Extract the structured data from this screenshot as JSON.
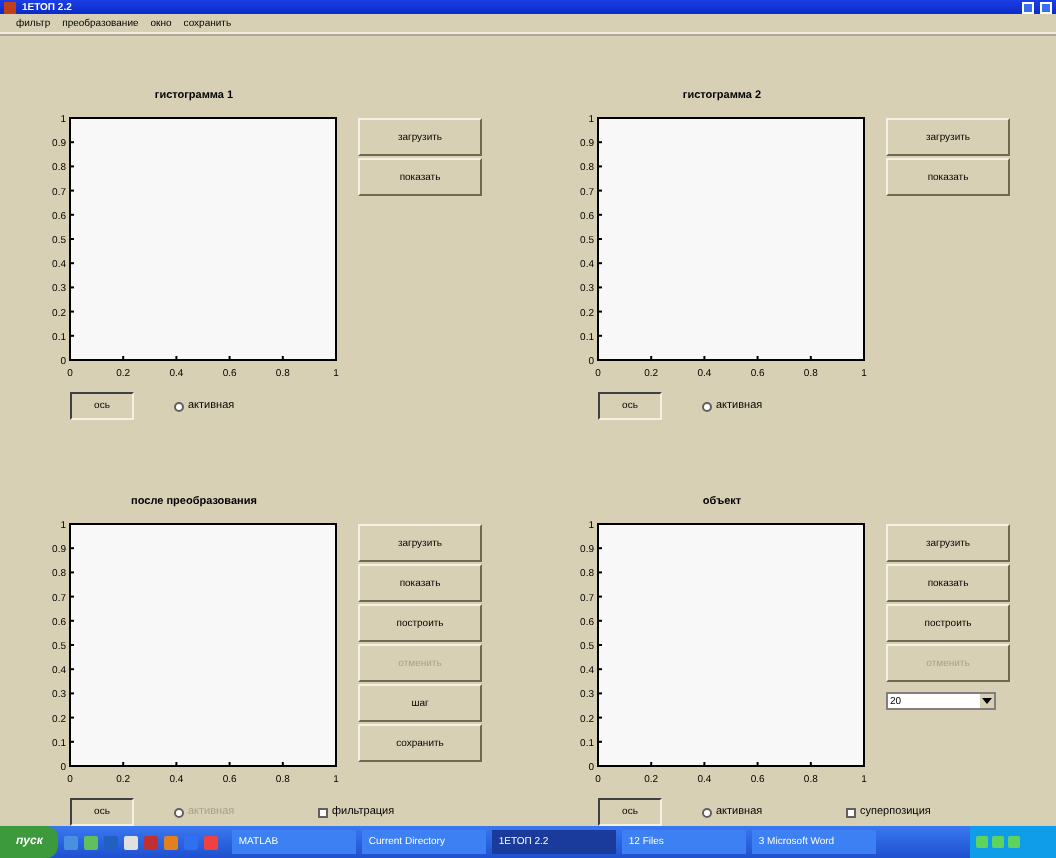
{
  "window": {
    "title": "1ЕТОП 2.2"
  },
  "menu": [
    "фильтр",
    "преобразование",
    "окно",
    "сохранить"
  ],
  "panels": [
    {
      "title": "гистограмма 1",
      "chart_data": {
        "type": "line",
        "xlim": [
          0,
          1
        ],
        "ylim": [
          0,
          1
        ],
        "xticks": [
          0,
          0.2,
          0.4,
          0.6,
          0.8,
          1
        ],
        "yticks": [
          0,
          0.1,
          0.2,
          0.3,
          0.4,
          0.5,
          0.6,
          0.7,
          0.8,
          0.9,
          1
        ]
      },
      "buttons": [
        {
          "label": "загрузить",
          "disabled": false
        },
        {
          "label": "показать",
          "disabled": false
        }
      ],
      "axis_field": {
        "value": "ось"
      },
      "options": [
        {
          "kind": "radio",
          "label": "активная",
          "checked": false,
          "disabled": false
        }
      ]
    },
    {
      "title": "гистограмма 2",
      "chart_data": {
        "type": "line",
        "xlim": [
          0,
          1
        ],
        "ylim": [
          0,
          1
        ],
        "xticks": [
          0,
          0.2,
          0.4,
          0.6,
          0.8,
          1
        ],
        "yticks": [
          0,
          0.1,
          0.2,
          0.3,
          0.4,
          0.5,
          0.6,
          0.7,
          0.8,
          0.9,
          1
        ]
      },
      "buttons": [
        {
          "label": "загрузить",
          "disabled": false
        },
        {
          "label": "показать",
          "disabled": false
        }
      ],
      "axis_field": {
        "value": "ось"
      },
      "options": [
        {
          "kind": "radio",
          "label": "активная",
          "checked": false,
          "disabled": false
        }
      ]
    },
    {
      "title": "после преобразования",
      "chart_data": {
        "type": "line",
        "xlim": [
          0,
          1
        ],
        "ylim": [
          0,
          1
        ],
        "xticks": [
          0,
          0.2,
          0.4,
          0.6,
          0.8,
          1
        ],
        "yticks": [
          0,
          0.1,
          0.2,
          0.3,
          0.4,
          0.5,
          0.6,
          0.7,
          0.8,
          0.9,
          1
        ]
      },
      "buttons": [
        {
          "label": "загрузить",
          "disabled": false
        },
        {
          "label": "показать",
          "disabled": false
        },
        {
          "label": "построить",
          "disabled": false
        },
        {
          "label": "отменить",
          "disabled": true
        },
        {
          "label": "шаг",
          "disabled": false
        },
        {
          "label": "сохранить",
          "disabled": false
        }
      ],
      "axis_field": {
        "value": "ось"
      },
      "options": [
        {
          "kind": "radio",
          "label": "активная",
          "checked": false,
          "disabled": true
        },
        {
          "kind": "checkbox",
          "label": "фильтрация",
          "checked": false,
          "disabled": false
        }
      ]
    },
    {
      "title": "объект",
      "chart_data": {
        "type": "line",
        "xlim": [
          0,
          1
        ],
        "ylim": [
          0,
          1
        ],
        "xticks": [
          0,
          0.2,
          0.4,
          0.6,
          0.8,
          1
        ],
        "yticks": [
          0,
          0.1,
          0.2,
          0.3,
          0.4,
          0.5,
          0.6,
          0.7,
          0.8,
          0.9,
          1
        ]
      },
      "buttons": [
        {
          "label": "загрузить",
          "disabled": false
        },
        {
          "label": "показать",
          "disabled": false
        },
        {
          "label": "построить",
          "disabled": false
        },
        {
          "label": "отменить",
          "disabled": true
        }
      ],
      "dropdown": {
        "value": "20"
      },
      "axis_field": {
        "value": "ось"
      },
      "options": [
        {
          "kind": "radio",
          "label": "активная",
          "checked": false,
          "disabled": false
        },
        {
          "kind": "checkbox",
          "label": "суперпозиция",
          "checked": false,
          "disabled": false
        }
      ]
    }
  ],
  "taskbar": {
    "start": "пуск",
    "tasks": [
      {
        "label": "MATLAB",
        "selected": false
      },
      {
        "label": "Current Directory",
        "selected": false
      },
      {
        "label": "1ЕТОП 2.2",
        "selected": true
      },
      {
        "label": "12 Files",
        "selected": false
      },
      {
        "label": "3 Microsoft Word",
        "selected": false
      }
    ]
  }
}
